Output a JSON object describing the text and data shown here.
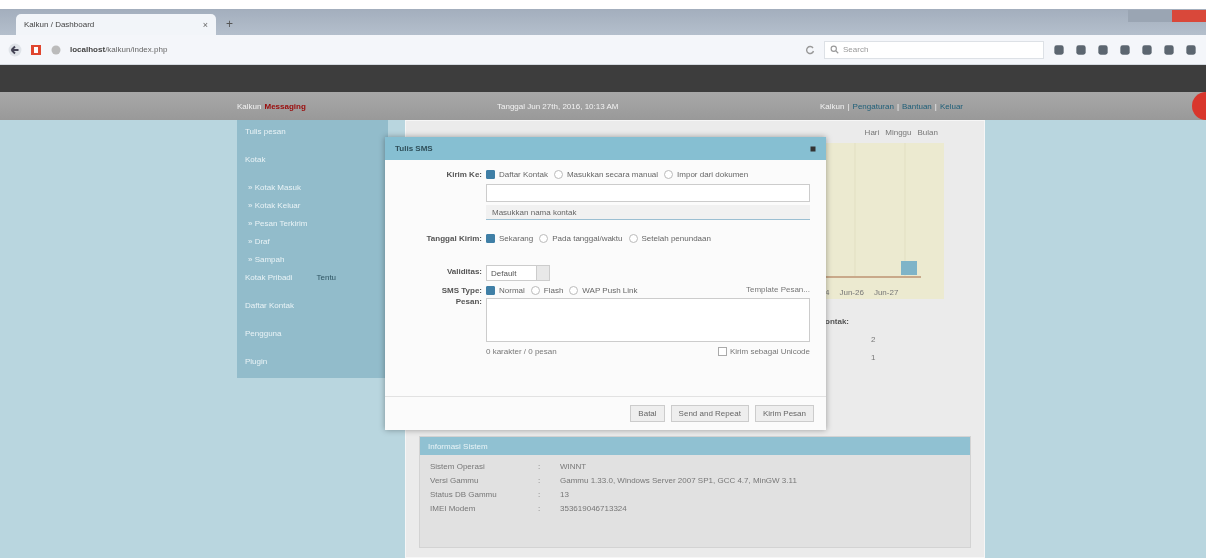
{
  "browser": {
    "tab_title": "Kalkun / Dashboard",
    "tab_close": "×",
    "new_tab": "+",
    "url_host": "localhost",
    "url_path": "/kalkun/index.php",
    "search_placeholder": "Search"
  },
  "header": {
    "brand": "Kalkun",
    "brand_accent": "Messaging",
    "date": "Tanggal Jun 27th, 2016, 10:13 AM",
    "user": "Kalkun",
    "links": [
      {
        "sep": "|",
        "label": "Pengaturan"
      },
      {
        "sep": "|",
        "label": "Bantuan"
      },
      {
        "sep": "|",
        "label": "Keluar"
      }
    ]
  },
  "sidebar": {
    "items": [
      {
        "label": "Tulis pesan"
      },
      {
        "label": "Kotak",
        "children": [
          {
            "label": "» Kotak Masuk"
          },
          {
            "label": "» Kotak Keluar"
          },
          {
            "label": "» Pesan Terkirim"
          },
          {
            "label": "» Draf"
          },
          {
            "label": "» Sampah"
          }
        ]
      },
      {
        "label": "Kotak Pribadi",
        "aside": "Tentu"
      },
      {
        "label": "Daftar Kontak"
      },
      {
        "label": "Pengguna"
      },
      {
        "label": "Plugin"
      }
    ]
  },
  "stats": {
    "tabs": [
      "Hari",
      "Minggu",
      "Bulan"
    ],
    "x_labels": [
      "4",
      "Jun-26",
      "Jun-27"
    ],
    "contact_label": "ontak:",
    "counts": [
      "2",
      "1"
    ]
  },
  "dialog": {
    "title": "Tulis SMS",
    "send_to": {
      "label": "Kirim Ke:",
      "options": [
        {
          "label": "Daftar Kontak",
          "selected": true
        },
        {
          "label": "Masukkan secara manual",
          "selected": false
        },
        {
          "label": "Impor dari dokumen",
          "selected": false
        }
      ],
      "hint": "Masukkan nama kontak"
    },
    "send_date": {
      "label": "Tanggal Kirim:",
      "options": [
        {
          "label": "Sekarang",
          "selected": true
        },
        {
          "label": "Pada tanggal/waktu",
          "selected": false
        },
        {
          "label": "Setelah penundaan",
          "selected": false
        }
      ]
    },
    "validity": {
      "label": "Validitas:",
      "value": "Default"
    },
    "sms_type": {
      "label": "SMS Type:",
      "options": [
        {
          "label": "Normal",
          "selected": true
        },
        {
          "label": "Flash",
          "selected": false
        },
        {
          "label": "WAP Push Link",
          "selected": false
        }
      ],
      "template_link": "Template Pesan..."
    },
    "message": {
      "label": "Pesan:",
      "counter": "0 karakter / 0 pesan",
      "unicode": {
        "label": "Kirim sebagai Unicode",
        "checked": false
      }
    },
    "buttons": [
      "Batal",
      "Send and Repeat",
      "Kirim Pesan"
    ]
  },
  "system": {
    "title": "Informasi Sistem",
    "rows": [
      {
        "label": "Sistem Operasi",
        "sep": ":",
        "value": "WINNT"
      },
      {
        "label": "Versi Gammu",
        "sep": ":",
        "value": "Gammu 1.33.0, Windows Server 2007 SP1, GCC 4.7, MinGW 3.11"
      },
      {
        "label": "Status DB Gammu",
        "sep": ":",
        "value": "13"
      },
      {
        "label": "IMEI Modem",
        "sep": ":",
        "value": "353619046713324"
      }
    ]
  }
}
